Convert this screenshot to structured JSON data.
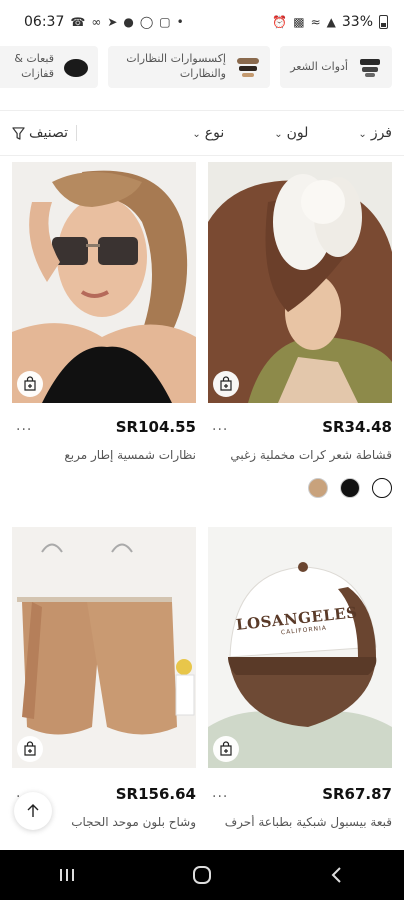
{
  "status_bar": {
    "time": "06:37",
    "battery": "33%",
    "left_icons": [
      "whatsapp-icon",
      "infinity-icon",
      "telegram-icon",
      "location-icon",
      "messenger-icon",
      "instagram-icon",
      "dot-icon"
    ],
    "right_icons": [
      "alarm-icon",
      "vibrate-icon",
      "wifi-icon",
      "signal-icon",
      "battery-icon"
    ]
  },
  "categories": [
    {
      "label": "أدوات الشعر",
      "thumb_color": "#2a2a2a"
    },
    {
      "label": "إكسسوارات النظارات والنظارات",
      "thumb_color": "#8a6a4e"
    },
    {
      "label": "قبعات & قفازات",
      "thumb_color": "#1a1a1a"
    }
  ],
  "filters": {
    "items": [
      {
        "label": "فرز"
      },
      {
        "label": "لون"
      },
      {
        "label": "نوع"
      }
    ],
    "sort_label": "تصنيف"
  },
  "products": [
    {
      "price": "SR34.48",
      "title": "قشاطة شعر كرات مخملية زغبي",
      "swatches": [
        "#ffffff",
        "#111111",
        "#c8a27c"
      ]
    },
    {
      "price": "SR104.55",
      "title": "نظارات شمسية إطار مربع",
      "swatches": []
    },
    {
      "price": "SR67.87",
      "title": "قبعة بيسبول شبكية بطباعة أحرف",
      "swatches": []
    },
    {
      "price": "SR156.64",
      "title": "وشاح بلون موحد الحجاب",
      "swatches": []
    }
  ],
  "cap_print": {
    "line1": "LOSANGELES",
    "line2": "CALIFORNIA"
  },
  "more_label": "...",
  "colors": {
    "brand_text": "#222222",
    "nav_bg": "#000000",
    "chip_bg": "#f4f4f4"
  }
}
